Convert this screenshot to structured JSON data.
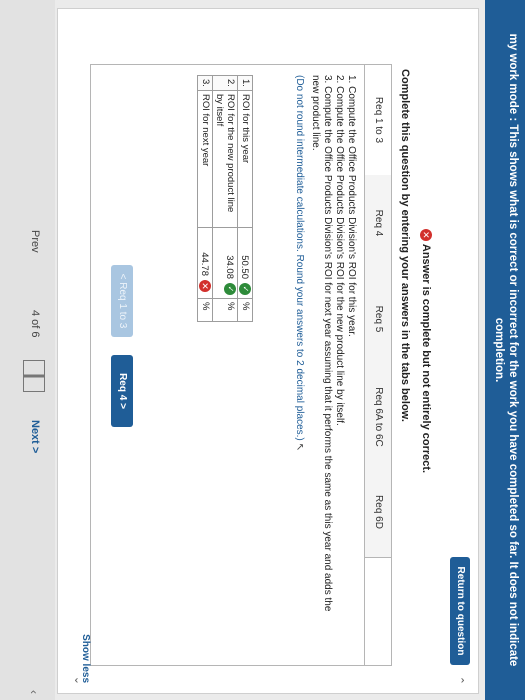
{
  "banner": {
    "line1": "my work mode : This shows what is correct or incorrect for the work you have completed so far. It does not indicate",
    "line2": "completion."
  },
  "header": {
    "return_label": "Return to question"
  },
  "status": {
    "text": "Answer is complete but not entirely correct."
  },
  "instruction": "Complete this question by entering your answers in the tabs below.",
  "tabs": [
    {
      "label": "Req 1 to 3"
    },
    {
      "label": "Req 4"
    },
    {
      "label": "Req 5"
    },
    {
      "label": "Req 6A to 6C"
    },
    {
      "label": "Req 6D"
    }
  ],
  "question": {
    "line1": "1. Compute the Office Products Division's ROI for this year.",
    "line2": "2. Compute the Office Products Division's ROI for the new product line by itself.",
    "line3": "3. Compute the Office Products Division's ROI for next year assuming that it performs the same as this year and adds the",
    "line3b": "new product line.",
    "note": "(Do not round intermediate calculations. Round your answers to 2 decimal places.)"
  },
  "table": {
    "rows": [
      {
        "num": "1.",
        "label": "ROI for this year",
        "value": "50.50",
        "unit": "%",
        "correct": true
      },
      {
        "num": "2.",
        "label": "ROI for the new product line by itself",
        "value": "34.08",
        "unit": "%",
        "correct": true
      },
      {
        "num": "3.",
        "label": "ROI for next year",
        "value": "44.78",
        "unit": "%",
        "correct": false
      }
    ]
  },
  "buttons": {
    "prev_label": "< Req 1 to 3",
    "next_label": "Req 4 >"
  },
  "show_less": "Show less",
  "footer": {
    "prev_label": "Prev",
    "page_label": "4 of 6",
    "next_label": "Next >"
  },
  "icons": {
    "status": "x-circle-icon",
    "correct": "check-circle-icon",
    "incorrect": "x-circle-icon"
  },
  "colors": {
    "brand": "#1f5d97",
    "correct": "#2e8b3a",
    "incorrect": "#d2302c"
  }
}
